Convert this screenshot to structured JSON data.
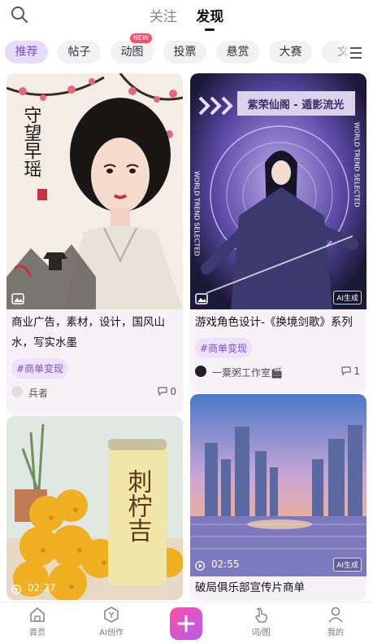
{
  "header": {
    "tabs": [
      {
        "label": "关注",
        "active": false
      },
      {
        "label": "发现",
        "active": true
      }
    ]
  },
  "chips": [
    {
      "label": "推荐",
      "active": true
    },
    {
      "label": "帖子"
    },
    {
      "label": "动图",
      "badge": "NEW"
    },
    {
      "label": "投票"
    },
    {
      "label": "悬赏"
    },
    {
      "label": "大赛"
    },
    {
      "label": "文"
    }
  ],
  "cards": [
    {
      "title": "商业广告，素材，设计，国风山水，写实水墨",
      "tag": "#商单变现",
      "author": "兵者",
      "comments": "0",
      "media_icon": "image-icon",
      "image_text": "守望早瑶"
    },
    {
      "title": "游戏角色设计-《换境剑歌》系列",
      "tag": "#商单变现",
      "author": "一粟粥工作室🎬",
      "comments": "1",
      "media_icon": "image-icon",
      "ai_badge": "AI生成",
      "banner_text": "紫荣仙阁 - 遁影流光",
      "side_text": "WORLD TREND SELECTED"
    },
    {
      "media_icon": "play-icon",
      "duration": "02:27",
      "can_text": "刺柠吉"
    },
    {
      "title": "破局俱乐部宣传片商单",
      "media_icon": "play-icon",
      "duration": "02:55",
      "ai_badge": "AI生成"
    }
  ],
  "bottom_nav": [
    {
      "label": "首页",
      "icon": "home-icon"
    },
    {
      "label": "AI创作",
      "icon": "ai-create-icon"
    },
    {
      "label": "",
      "icon": "plus-icon"
    },
    {
      "label": "词/图",
      "icon": "prompt-icon"
    },
    {
      "label": "我的",
      "icon": "profile-icon"
    }
  ],
  "colors": {
    "accent": "#7b4fd6",
    "tag_bg": "#ece2fb",
    "plus_gradient_start": "#ff4fa3",
    "plus_gradient_end": "#b35cf0"
  }
}
